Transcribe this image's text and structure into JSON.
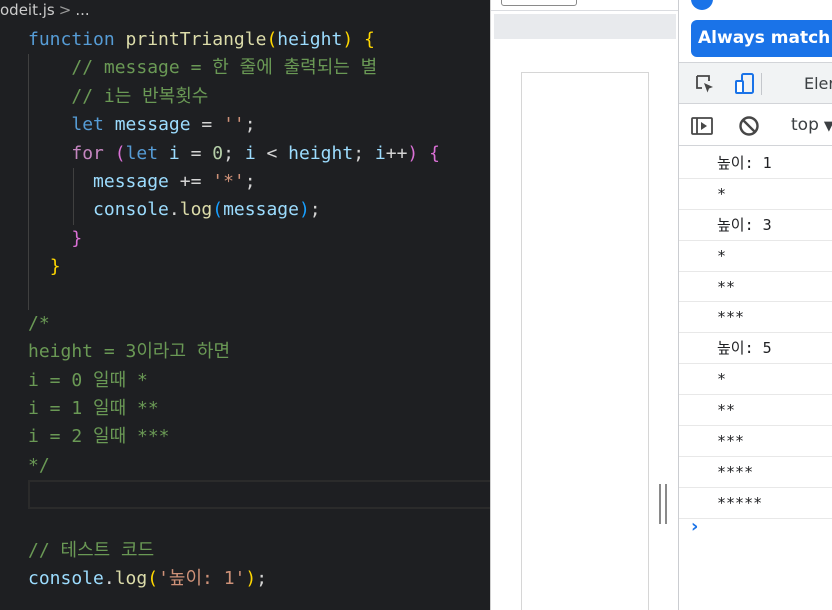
{
  "editor": {
    "breadcrumb": {
      "file": "odeit.js",
      "sep": ">",
      "more": "..."
    },
    "code": {
      "l1": {
        "k": "function",
        "f": "printTriangle",
        "o": "(",
        "p": "height",
        "c": ")",
        "b": "{"
      },
      "l2": {
        "c": "// message = 한 줄에 출력되는 별"
      },
      "l3": {
        "c": "// i는 반복횟수"
      },
      "l4": {
        "k": "let",
        "v": "message",
        "eq": " = ",
        "s": "''",
        "sc": ";"
      },
      "l5": {
        "k": "for",
        "o": "(",
        "k2": "let",
        "v1": "i",
        "eq": " = ",
        "n": "0",
        "sc1": "; ",
        "v2": "i",
        "lt": " < ",
        "v3": "height",
        "sc2": "; ",
        "v4": "i",
        "inc": "++",
        "c": ")",
        "b": "{"
      },
      "l6": {
        "v": "message",
        "op": " += ",
        "s": "'*'",
        "sc": ";"
      },
      "l7": {
        "v": "console",
        "d": ".",
        "f": "log",
        "o": "(",
        "a": "message",
        "c": ")",
        "sc": ";"
      },
      "l8": {
        "b": "}"
      },
      "l9": {
        "b": "}"
      },
      "l11": {
        "c": "/*"
      },
      "l12": {
        "c": "height = 3이라고 하면"
      },
      "l13": {
        "c": "i = 0 일때 *"
      },
      "l14": {
        "c": "i = 1 일때 **"
      },
      "l15": {
        "c": "i = 2 일때 ***"
      },
      "l16": {
        "c": "*/"
      },
      "l19": {
        "c": "// 테스트 코드"
      },
      "l20": {
        "v": "console",
        "d": ".",
        "f": "log",
        "o": "(",
        "s": "'높이: 1'",
        "c": ")",
        "sc": ";"
      }
    }
  },
  "devtools": {
    "match_button_label": "Always match C",
    "elements_tab_label": "Eler",
    "context_label": "top",
    "chevron": "▼",
    "prompt": "›",
    "console_logs": [
      "높이: 1",
      "*",
      "높이: 3",
      "*",
      "**",
      "***",
      "높이: 5",
      "*",
      "**",
      "***",
      "****",
      "*****"
    ]
  },
  "colors": {
    "editor_bg": "#1e1f22",
    "accent_blue": "#1a73e8",
    "keyword": "#569cd6",
    "control": "#c586c0",
    "function": "#dcdcaa",
    "variable": "#9cdcfe",
    "string": "#ce9178",
    "comment": "#6a9955"
  }
}
